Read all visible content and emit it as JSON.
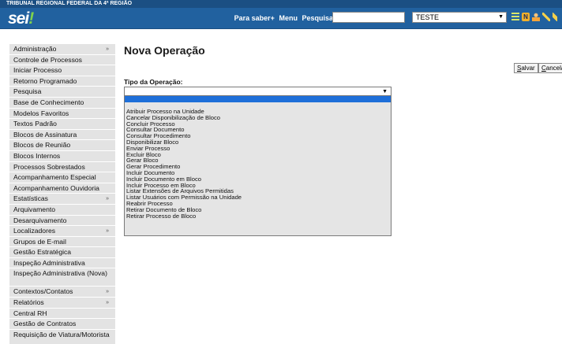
{
  "header": {
    "organization": "TRIBUNAL REGIONAL FEDERAL DA 4ª REGIÃO",
    "logo_text": "sei",
    "logo_dot": "!",
    "links": [
      "Para saber+",
      "Menu",
      "Pesquisa"
    ],
    "search_value": "",
    "unit_selected": "TESTE",
    "icons": [
      "list-icon",
      "notice-n-icon",
      "user-icon",
      "wrench-icon",
      "tools-icon"
    ]
  },
  "sidebar": {
    "items": [
      {
        "label": "Administração",
        "has_submenu": true
      },
      {
        "label": "Controle de Processos",
        "has_submenu": false
      },
      {
        "label": "Iniciar Processo",
        "has_submenu": false
      },
      {
        "label": "Retorno Programado",
        "has_submenu": false
      },
      {
        "label": "Pesquisa",
        "has_submenu": false
      },
      {
        "label": "Base de Conhecimento",
        "has_submenu": false
      },
      {
        "label": "Modelos Favoritos",
        "has_submenu": false
      },
      {
        "label": "Textos Padrão",
        "has_submenu": false
      },
      {
        "label": "Blocos de Assinatura",
        "has_submenu": false
      },
      {
        "label": "Blocos de Reunião",
        "has_submenu": false
      },
      {
        "label": "Blocos Internos",
        "has_submenu": false
      },
      {
        "label": "Processos Sobrestados",
        "has_submenu": false
      },
      {
        "label": "Acompanhamento Especial",
        "has_submenu": false
      },
      {
        "label": "Acompanhamento Ouvidoria",
        "has_submenu": false
      },
      {
        "label": "Estatísticas",
        "has_submenu": true
      },
      {
        "label": "Arquivamento",
        "has_submenu": false
      },
      {
        "label": "Desarquivamento",
        "has_submenu": false
      },
      {
        "label": "Localizadores",
        "has_submenu": true
      },
      {
        "label": "Grupos de E-mail",
        "has_submenu": false
      },
      {
        "label": "Gestão Estratégica",
        "has_submenu": false
      },
      {
        "label": "Inspeção Administrativa",
        "has_submenu": false
      },
      {
        "label": "Inspeção Administrativa (Nova)",
        "has_submenu": false
      },
      {
        "label": "Contextos/Contatos",
        "has_submenu": true
      },
      {
        "label": "Relatórios",
        "has_submenu": true
      },
      {
        "label": "Central RH",
        "has_submenu": false
      },
      {
        "label": "Gestão de Contratos",
        "has_submenu": false
      },
      {
        "label": "Requisição de Viatura/Motorista",
        "has_submenu": false
      }
    ],
    "submenu_arrow": "»"
  },
  "main": {
    "title": "Nova Operação",
    "save_label_underlined": "S",
    "save_label_rest": "alvar",
    "cancel_label_underlined": "C",
    "cancel_label_rest": "ancelar",
    "operation_type_label": "Tipo da Operação:",
    "operation_type_selected": "",
    "operation_options": [
      "",
      "",
      "Atribuir Processo na Unidade",
      "Cancelar Disponibilização de Bloco",
      "Concluir Processo",
      "Consultar Documento",
      "Consultar Procedimento",
      "Disponibilizar Bloco",
      "Enviar Processo",
      "Excluir Bloco",
      "Gerar Bloco",
      "Gerar Procedimento",
      "Incluir Documento",
      "Incluir Documento em Bloco",
      "Incluir Processo em Bloco",
      "Listar Extensões de Arquivos Permitidas",
      "Listar Usuários com Permissão na Unidade",
      "Reabrir Processo",
      "Retirar Documento de Bloco",
      "Retirar Processo de Bloco"
    ]
  }
}
